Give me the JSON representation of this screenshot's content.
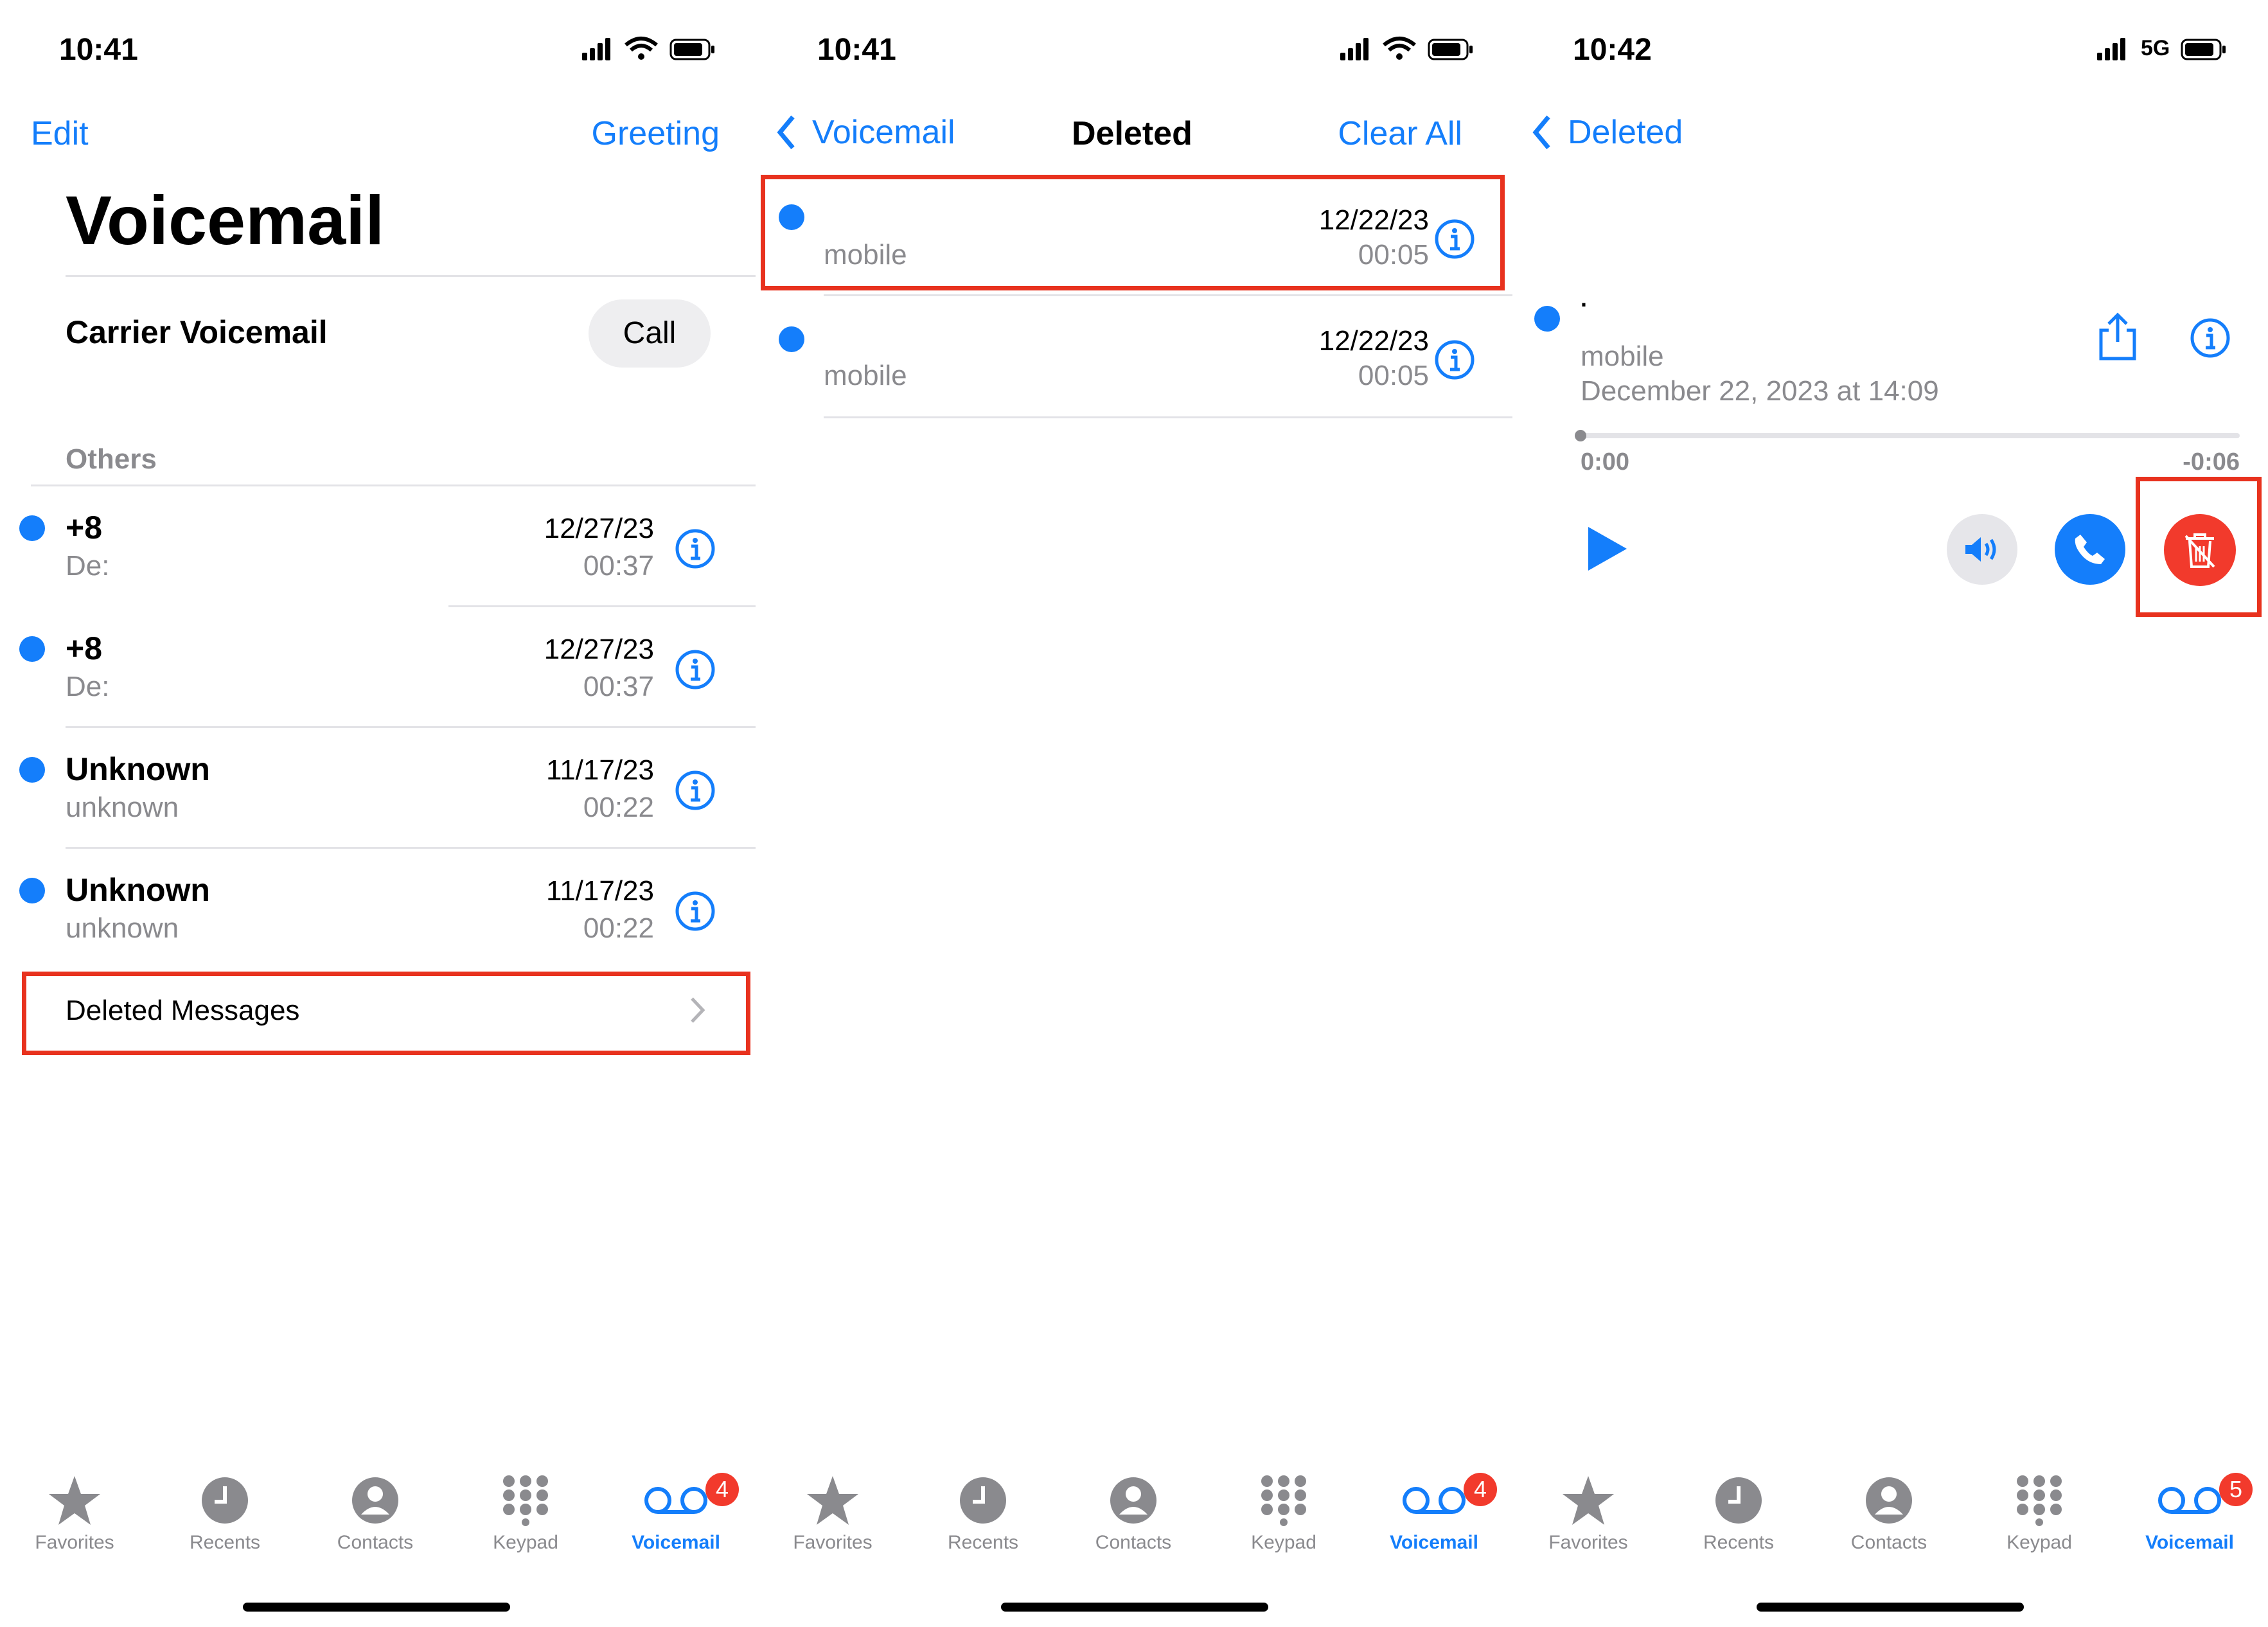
{
  "panel1": {
    "status_time": "10:41",
    "nav": {
      "left": "Edit",
      "right": "Greeting"
    },
    "title": "Voicemail",
    "carrier": {
      "label": "Carrier Voicemail",
      "button": "Call"
    },
    "section": "Others",
    "rows": [
      {
        "title": "+8",
        "sub": "De:",
        "date": "12/27/23",
        "dur": "00:37"
      },
      {
        "title": "+8",
        "sub": "De:",
        "date": "12/27/23",
        "dur": "00:37"
      },
      {
        "title": "Unknown",
        "sub": "unknown",
        "date": "11/17/23",
        "dur": "00:22"
      },
      {
        "title": "Unknown",
        "sub": "unknown",
        "date": "11/17/23",
        "dur": "00:22"
      }
    ],
    "deleted": "Deleted Messages",
    "badge": "4"
  },
  "panel2": {
    "status_time": "10:41",
    "nav": {
      "back": "Voicemail",
      "title": "Deleted",
      "right": "Clear All"
    },
    "rows": [
      {
        "sub": "mobile",
        "date": "12/22/23",
        "dur": "00:05"
      },
      {
        "sub": "mobile",
        "date": "12/22/23",
        "dur": "00:05"
      }
    ],
    "badge": "4"
  },
  "panel3": {
    "status_time": "10:42",
    "network": "5G",
    "nav": {
      "back": "Deleted"
    },
    "name": ".",
    "sub": "mobile",
    "datetime": "December 22, 2023 at 14:09",
    "elapsed": "0:00",
    "remaining": "-0:06",
    "progress": 0,
    "badge": "5"
  },
  "tabs": [
    {
      "label": "Favorites",
      "icon": "star-icon"
    },
    {
      "label": "Recents",
      "icon": "clock-icon"
    },
    {
      "label": "Contacts",
      "icon": "person-icon"
    },
    {
      "label": "Keypad",
      "icon": "keypad-icon"
    },
    {
      "label": "Voicemail",
      "icon": "voicemail-icon"
    }
  ],
  "colors": {
    "accent": "#147efb",
    "highlight": "#e8321e",
    "badge": "#f23a2c",
    "gray": "#8a8a8e"
  }
}
